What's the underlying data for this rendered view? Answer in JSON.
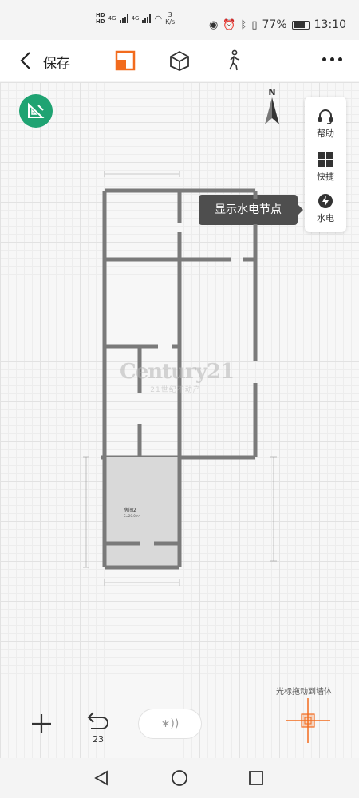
{
  "status_bar": {
    "hd1": "HD",
    "hd2": "HD",
    "net1": "4G",
    "net2": "4G",
    "speed_value": "3",
    "speed_unit": "K/s",
    "battery": "77%",
    "time": "13:10"
  },
  "toolbar": {
    "save_label": "保存",
    "icons": [
      "floorplan-2d-icon",
      "cube-3d-icon",
      "walk-person-icon",
      "more-icon"
    ],
    "accent_color": "#f26b1d"
  },
  "side_panel": {
    "help_label": "帮助",
    "shortcut_label": "快捷",
    "water_elec_label": "水电"
  },
  "tooltip": {
    "text": "显示水电节点"
  },
  "compass": {
    "label": "N"
  },
  "watermark": {
    "brand": "Century21",
    "tagline": "21世纪不动产"
  },
  "room": {
    "name": "房间2",
    "area": "S=20.0m²"
  },
  "canvas_hint": "光标拖动到墙体",
  "bottom_tools": {
    "undo_count": "23",
    "bluetooth_label": "∗))"
  },
  "colors": {
    "measure_button": "#1fa372",
    "wall": "#7a7a7a",
    "room_fill": "#d9d9d9",
    "cursor": "#f26b1d"
  }
}
